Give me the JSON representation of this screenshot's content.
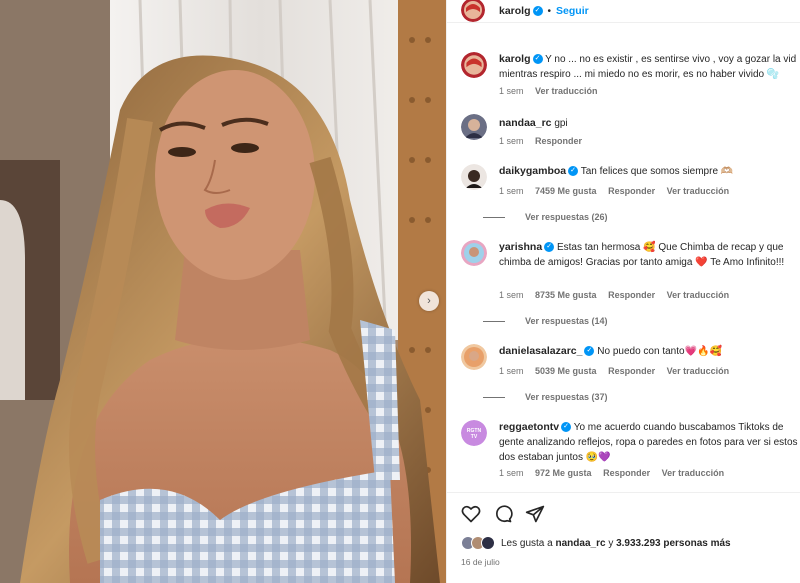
{
  "header": {
    "username": "karolg",
    "dot": "•",
    "follow_label": "Seguir"
  },
  "caption": {
    "username": "karolg",
    "text_line1": "Y no ... no es existir , es sentirse vivo , voy a gozar la vid",
    "text_line2": "mientras respiro ... mi miedo no es morir, es no haber vivido 🫧",
    "time": "1 sem",
    "translate": "Ver traducción"
  },
  "comments": [
    {
      "username": "nandaa_rc",
      "text": "gpi",
      "time": "1 sem",
      "reply": "Responder"
    },
    {
      "username": "daikygamboa",
      "text": "Tan felices que somos siempre 🫶🏼",
      "time": "1 sem",
      "likes": "7459 Me gusta",
      "reply": "Responder",
      "translate": "Ver traducción",
      "replies": "Ver respuestas (26)"
    },
    {
      "username": "yarishna",
      "text": "Estas tan hermosa 🥰 Que Chimba de recap y que chimba de amigos! Gracias por tanto amiga ❤️ Te Amo Infinito!!!",
      "time": "1 sem",
      "likes": "8735 Me gusta",
      "reply": "Responder",
      "translate": "Ver traducción",
      "replies": "Ver respuestas (14)"
    },
    {
      "username": "danielasalazarc_",
      "text": "No puedo con tanto💗🔥🥰",
      "time": "1 sem",
      "likes": "5039 Me gusta",
      "reply": "Responder",
      "translate": "Ver traducción",
      "replies": "Ver respuestas (37)"
    },
    {
      "username": "reggaetontv",
      "text": "Yo me acuerdo cuando buscabamos Tiktoks de gente analizando reflejos, ropa o paredes en fotos para ver si estos dos estaban juntos 🥹💜",
      "time": "1 sem",
      "likes": "972 Me gusta",
      "reply": "Responder",
      "translate": "Ver traducción"
    }
  ],
  "actions": {
    "likes_prefix": "Les gusta a",
    "likes_user": "nandaa_rc",
    "likes_mid": "y",
    "likes_count": "3.933.293 personas más",
    "date": "16 de julio"
  },
  "icons": {
    "heart": "heart-icon",
    "comment": "comment-icon",
    "share": "share-icon",
    "verified": "verified-badge-icon",
    "next": "chevron-right-icon"
  },
  "colors": {
    "accent": "#0095f6",
    "muted": "#737373",
    "text": "#262626"
  }
}
